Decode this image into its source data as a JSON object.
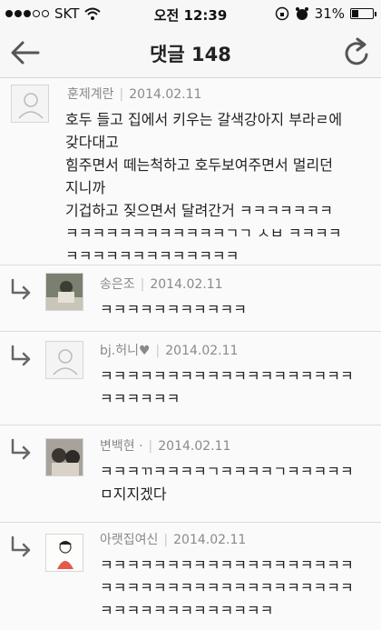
{
  "status": {
    "carrier": "SKT",
    "time": "오전 12:39",
    "battery": "31%",
    "battery_level": 0.31
  },
  "nav": {
    "title": "댓글 148",
    "back_icon": "arrow-left-icon",
    "refresh_icon": "refresh-icon"
  },
  "comments": [
    {
      "author": "훈제계란",
      "date": "2014.02.11",
      "avatar": "default-avatar",
      "text": "호두 들고 집에서 키우는 갈색강아지 부라ㄹ에\n갖다대고\n힘주면서 떼는척하고 호두보여주면서 멀리던\n지니까\n기겁하고 짖으면서 달려간거 ㅋㅋㅋㅋㅋㅋㅋ\nㅋㅋㅋㅋㅋㅋㅋㅋㅋㅋㅋㅋㄱㄱ ㅅㅂ ㅋㅋㅋㅋ\nㅋㅋㅋㅋㅋㅋㅋㅋㅋㅋㅋㅋㅋ"
    },
    {
      "author": "송은조",
      "date": "2014.02.11",
      "avatar": "photo-avatar",
      "text": "ㅋㅋㅋㅋㅋㅋㅋㅋㅋㅋㅋ"
    },
    {
      "author": "bj.허니♥",
      "date": "2014.02.11",
      "avatar": "default-avatar",
      "text": "ㅋㅋㅋㅋㅋㅋㅋㅋㅋㅋㅋㅋㅋㅋㅋㅋㅋㅋㅋ\nㅋㅋㅋㅋㅋㅋ"
    },
    {
      "author": "변백현 ·",
      "date": "2014.02.11",
      "avatar": "photo-avatar",
      "text": "ㅋㅋㅋㄲㅋㅋㅋㅋㄱㅋㅋㅋㅋㄱㅋㅋㅋㅋㅋ\nㅁ지지겠다"
    },
    {
      "author": "아랫집여신",
      "date": "2014.02.11",
      "avatar": "drawing-avatar",
      "text": "ㅋㅋㅋㅋㅋㅋㅋㅋㅋㅋㅋㅋㅋㅋㅋㅋㅋㅋㅋ\nㅋㅋㅋㅋㅋㅋㅋㅋㅋㅋㅋㅋㅋㅋㅋㅋㅋㅋㅋ\nㅋㅋㅋㅋㅋㅋㅋㅋㅋㅋㅋㅋㅋ"
    }
  ]
}
